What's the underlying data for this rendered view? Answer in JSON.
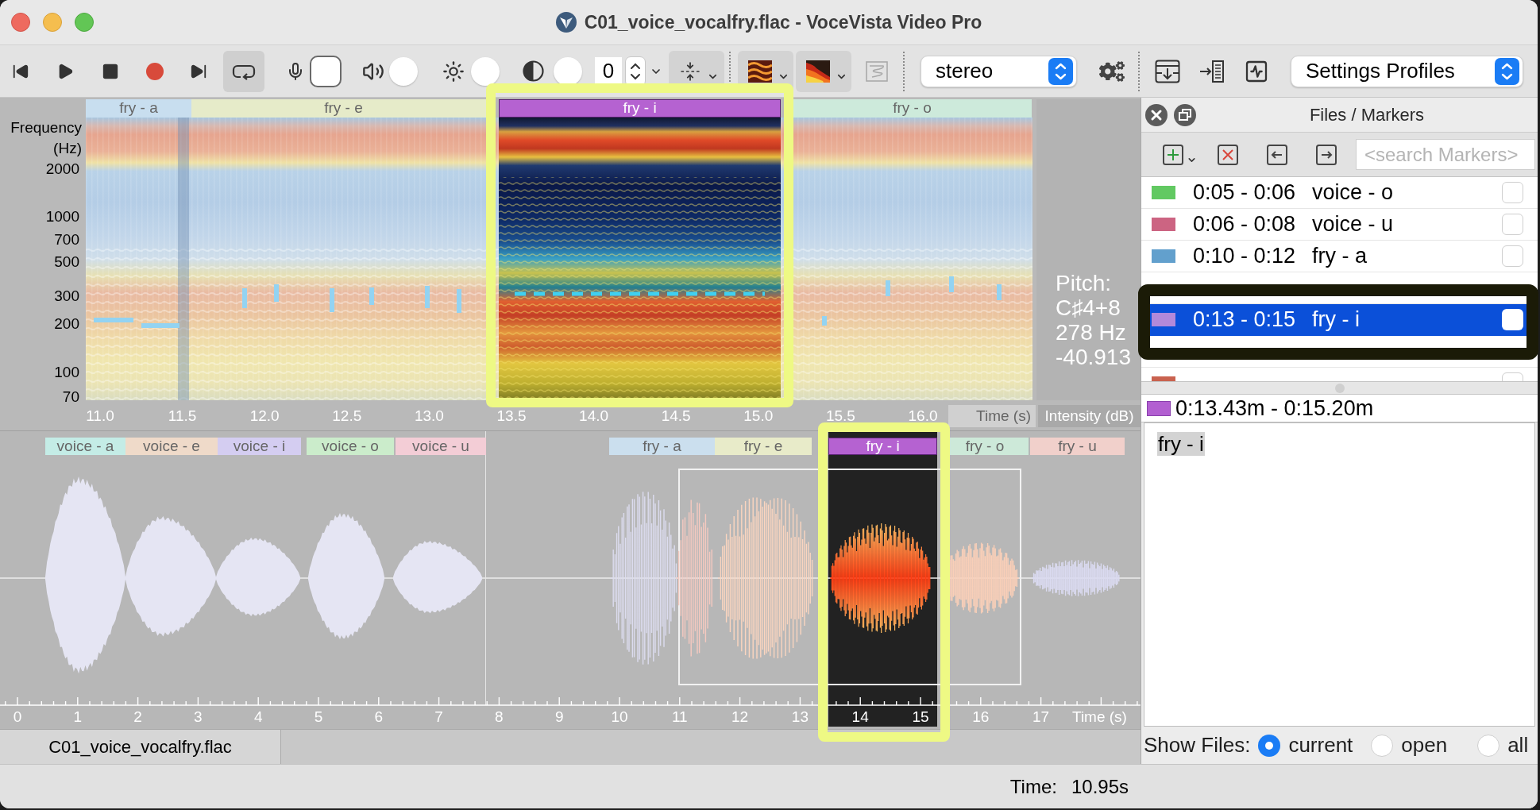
{
  "window": {
    "title": "C01_voice_vocalfry.flac - VoceVista Video Pro"
  },
  "toolbar": {
    "loop_button": {
      "on": true
    },
    "number_field": {
      "value": "0"
    },
    "fold_button": {
      "on": true
    },
    "colormap_button": {
      "on": true
    },
    "spectrum_button": {
      "on": true
    },
    "graph_button": {
      "disabled": true
    },
    "channel_select": {
      "value": "stereo"
    },
    "profiles_select": {
      "value": "Settings Profiles"
    }
  },
  "spectrogram": {
    "frequency_axis_title": "Frequency (Hz)",
    "frequency_ticks": [
      "2000",
      "1000",
      "700",
      "500",
      "300",
      "200",
      "100",
      "70"
    ],
    "time_ticks": [
      "11.0",
      "11.5",
      "12.0",
      "12.5",
      "13.0",
      "13.5",
      "14.0",
      "14.5",
      "15.0",
      "15.5",
      "16.0"
    ],
    "time_axis_title": "Time (s)",
    "intensity_axis_title": "Intensity (dB)",
    "markers": [
      {
        "label": "fry - a",
        "color": "#c8deef",
        "selected": false
      },
      {
        "label": "fry - e",
        "color": "#e6ebc9",
        "selected": false
      },
      {
        "label": "fry - i",
        "color": "#b562d1",
        "selected": true
      },
      {
        "label": "fry - o",
        "color": "#cdeadb",
        "selected": false
      }
    ],
    "pitch_readout": [
      "Pitch:",
      "C♯4+8",
      "278 Hz",
      "-40.913"
    ]
  },
  "waveform": {
    "markers": [
      {
        "label": "voice - a",
        "color": "#c4ece6",
        "selected": false
      },
      {
        "label": "voice - e",
        "color": "#efdac9",
        "selected": false
      },
      {
        "label": "voice - i",
        "color": "#d4cdf1",
        "selected": false
      },
      {
        "label": "voice - o",
        "color": "#cbeccb",
        "selected": false
      },
      {
        "label": "voice - u",
        "color": "#f3cdd6",
        "selected": false
      },
      {
        "label": "fry - a",
        "color": "#cbdfee",
        "selected": false
      },
      {
        "label": "fry - e",
        "color": "#e8ebc9",
        "selected": false
      },
      {
        "label": "fry - i",
        "color": "#b562d1",
        "selected": true
      },
      {
        "label": "fry - o",
        "color": "#cde9d9",
        "selected": false
      },
      {
        "label": "fry - u",
        "color": "#f1d0cb",
        "selected": false
      }
    ],
    "time_ticks": [
      "0",
      "1",
      "2",
      "3",
      "4",
      "5",
      "6",
      "7",
      "8",
      "9",
      "10",
      "11",
      "12",
      "13",
      "14",
      "15",
      "16",
      "17"
    ],
    "time_axis_title": "Time (s)"
  },
  "file_tabs": [
    {
      "label": "C01_voice_vocalfry.flac",
      "selected": true
    }
  ],
  "status_bar": {
    "label": "Time:",
    "value": "10.95s"
  },
  "markers_panel": {
    "title": "Files / Markers",
    "search": {
      "placeholder": "<search Markers>"
    },
    "rows": [
      {
        "time": "0:05 - 0:06",
        "label": "voice - o",
        "color": "#62c962",
        "checked": false,
        "selected": false
      },
      {
        "time": "0:06 - 0:08",
        "label": "voice - u",
        "color": "#cc6482",
        "checked": false,
        "selected": false
      },
      {
        "time": "0:10 - 0:12",
        "label": "fry - a",
        "color": "#62a0cd",
        "checked": false,
        "selected": false
      },
      {
        "selected": false
      },
      {
        "time": "0:13 - 0:15",
        "label": "fry - i",
        "color": "#b389da",
        "checked": false,
        "selected": true
      },
      {
        "selected": false
      },
      {
        "color": "#c9624f",
        "checked": false,
        "selected": false
      }
    ],
    "selection": {
      "color": "#b25fd1",
      "range": "0:13.43m - 0:15.20m"
    },
    "note": {
      "text": "fry - i",
      "selected": true
    },
    "show_files": {
      "label": "Show Files:",
      "options": [
        {
          "label": "current",
          "selected": true
        },
        {
          "label": "open",
          "selected": false
        },
        {
          "label": "all",
          "selected": false
        }
      ]
    }
  }
}
